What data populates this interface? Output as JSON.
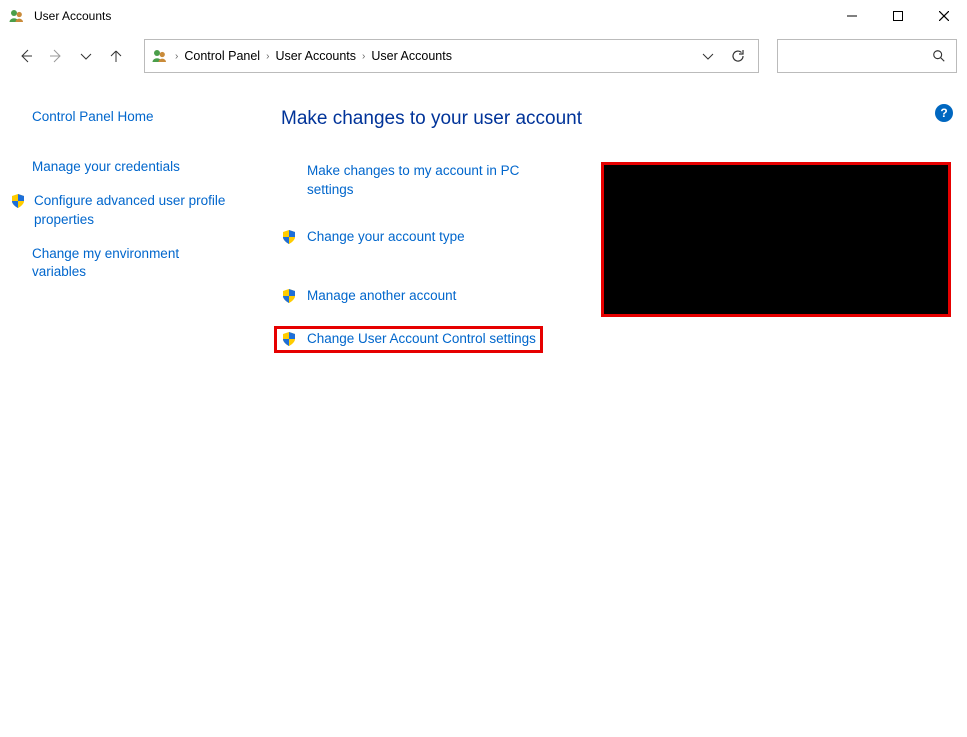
{
  "window": {
    "title": "User Accounts"
  },
  "breadcrumbs": {
    "items": [
      "Control Panel",
      "User Accounts",
      "User Accounts"
    ]
  },
  "sidebar": {
    "items": [
      {
        "label": "Control Panel Home",
        "shield": false
      },
      {
        "label": "Manage your credentials",
        "shield": false
      },
      {
        "label": "Configure advanced user profile properties",
        "shield": true
      },
      {
        "label": "Change my environment variables",
        "shield": false
      }
    ]
  },
  "main": {
    "heading": "Make changes to your user account",
    "actions": [
      {
        "label": "Make changes to my account in PC settings",
        "shield": false
      },
      {
        "label": "Change your account type",
        "shield": true
      },
      {
        "label": "Manage another account",
        "shield": true
      },
      {
        "label": "Change User Account Control settings",
        "shield": true,
        "highlighted": true
      }
    ]
  },
  "help": {
    "symbol": "?"
  }
}
